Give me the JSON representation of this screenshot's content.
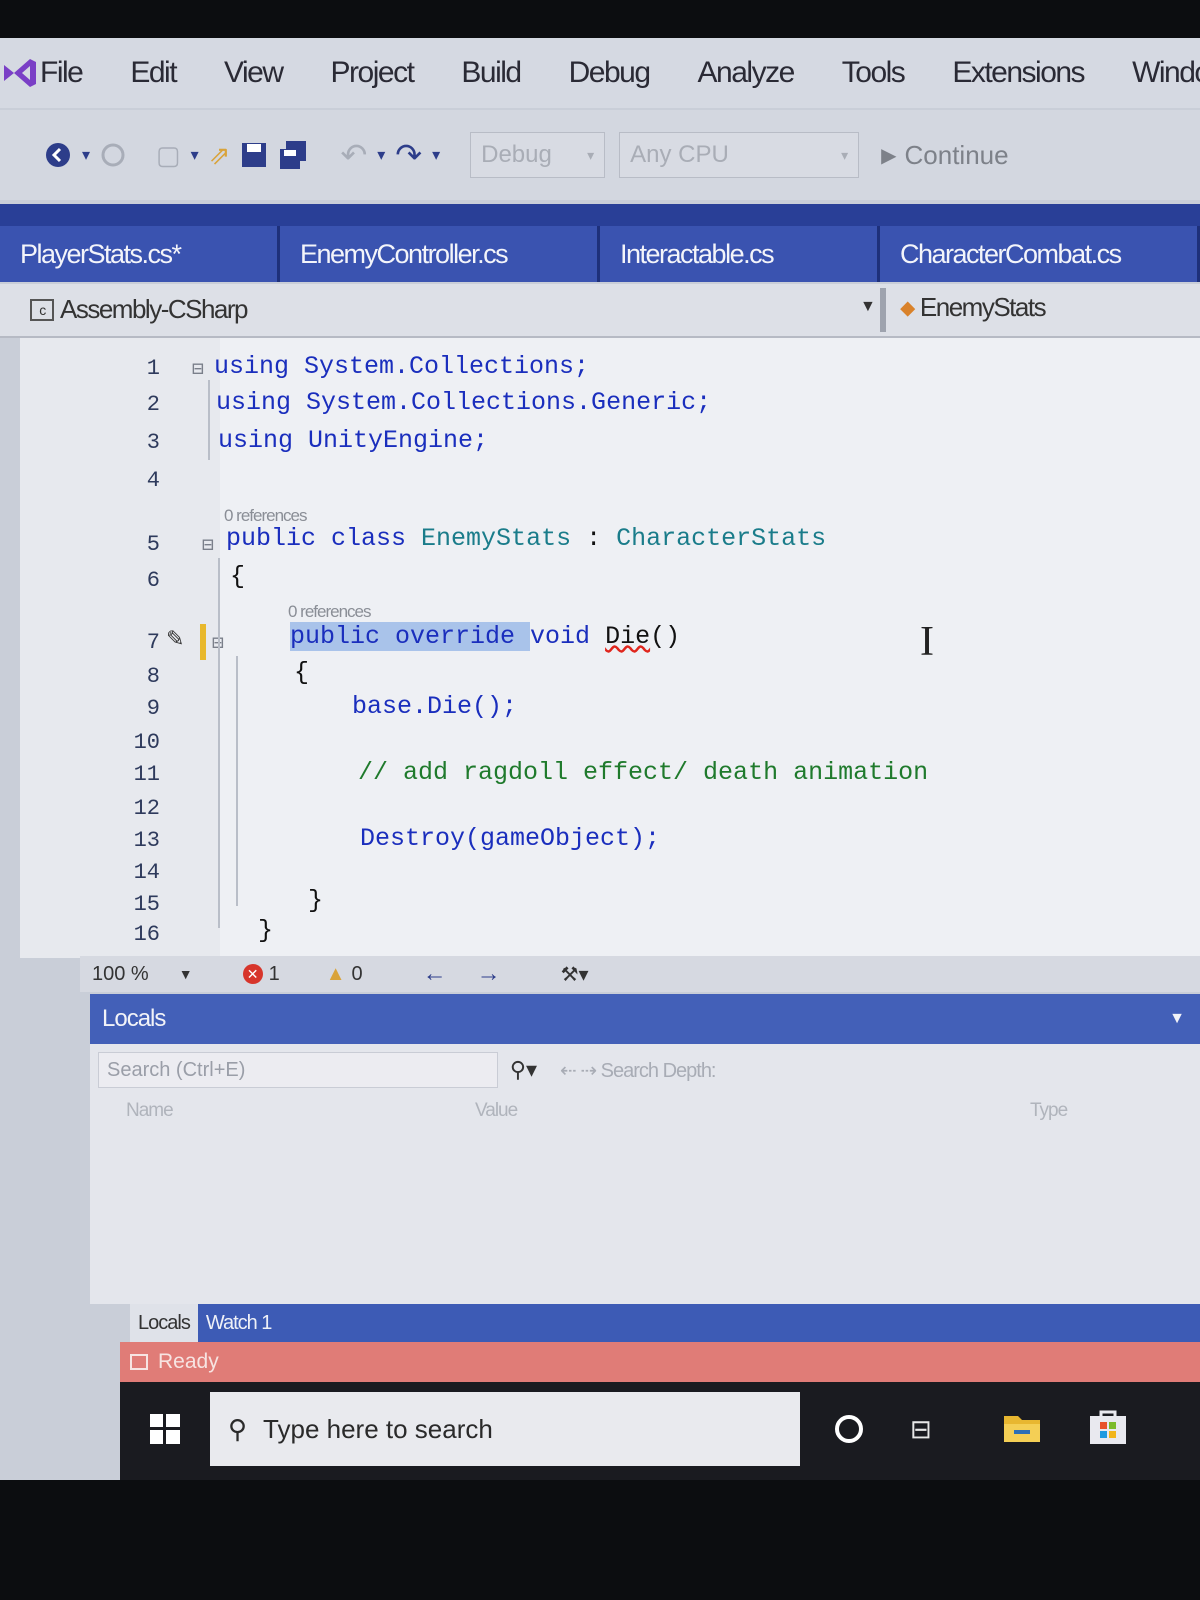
{
  "menu": [
    "File",
    "Edit",
    "View",
    "Project",
    "Build",
    "Debug",
    "Analyze",
    "Tools",
    "Extensions",
    "Windo"
  ],
  "toolbar": {
    "config": "Debug",
    "platform": "Any CPU",
    "continue": "Continue"
  },
  "tabs": [
    "PlayerStats.cs*",
    "EnemyController.cs",
    "Interactable.cs",
    "CharacterCombat.cs"
  ],
  "nav": {
    "project": "Assembly-CSharp",
    "class": "EnemyStats"
  },
  "code": {
    "line_numbers": [
      "1",
      "2",
      "3",
      "4",
      "5",
      "6",
      "7",
      "8",
      "9",
      "10",
      "11",
      "12",
      "13",
      "14",
      "15",
      "16"
    ],
    "references": "0 references",
    "l1": "using System.Collections;",
    "l2": "using System.Collections.Generic;",
    "l3": "using UnityEngine;",
    "l5_kw": "public class ",
    "l5_name": "EnemyStats",
    "l5_sep": " : ",
    "l5_base": "CharacterStats",
    "l6": "{",
    "l7_sel": "public override ",
    "l7_kw": "void ",
    "l7_method": "Die",
    "l7_paren": "()",
    "l8": "{",
    "l9": "base.Die();",
    "l11": "// add ragdoll effect/ death animation",
    "l13": "Destroy(gameObject);",
    "l15": "}",
    "l16": "}"
  },
  "editor_status": {
    "zoom": "100 %",
    "errors": "1",
    "warnings": "0"
  },
  "locals": {
    "title": "Locals",
    "search_placeholder": "Search (Ctrl+E)",
    "search_depth": "Search Depth:",
    "columns": [
      "Name",
      "Value",
      "Type"
    ],
    "tabs": [
      "Locals",
      "Watch 1"
    ]
  },
  "status": "Ready",
  "taskbar": {
    "search_placeholder": "Type here to search"
  },
  "colors": {
    "accent": "#293f97",
    "status_bar": "#e07c77",
    "keyword": "#1a2ebd",
    "type": "#1a7c8a",
    "comment": "#1f7a2c"
  }
}
